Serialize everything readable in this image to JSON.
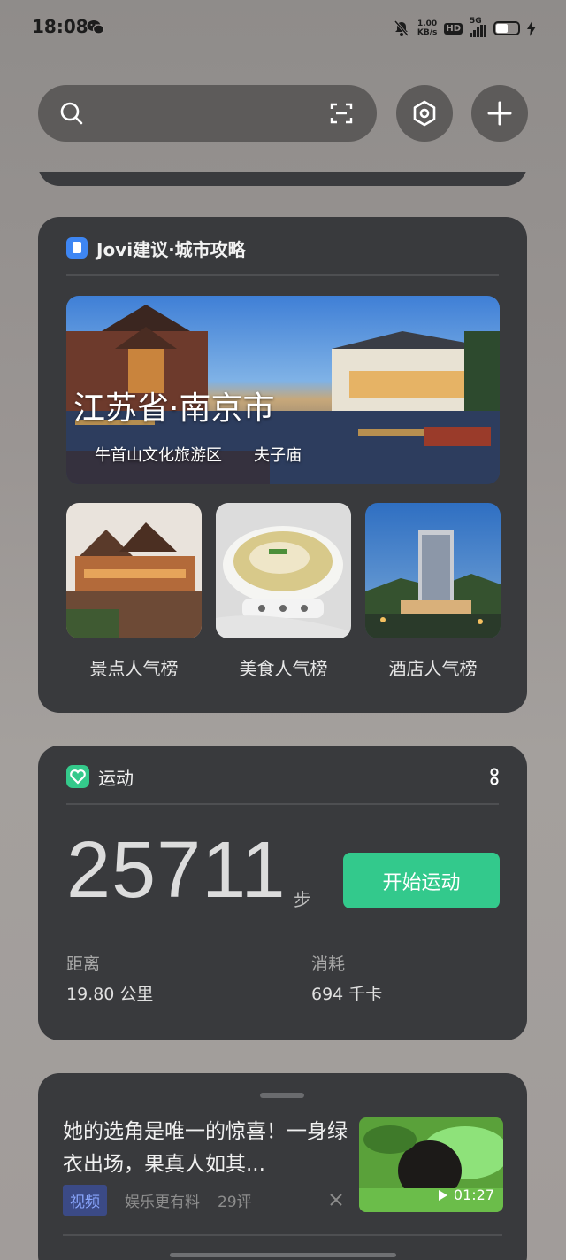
{
  "status_bar": {
    "time": "18:08",
    "net_speed_value": "1.00",
    "net_speed_unit": "KB/s",
    "hd_label": "HD",
    "network_label": "5G",
    "battery_level": 0.55,
    "icons": [
      "wechat-icon",
      "mute-icon",
      "signal-icon",
      "battery-icon",
      "charging-icon"
    ]
  },
  "search": {
    "icons": [
      "search-icon",
      "scan-icon"
    ]
  },
  "top_buttons": {
    "icons": [
      "settings-icon",
      "add-icon"
    ]
  },
  "jovi_card": {
    "title": "Jovi建议·城市攻略",
    "city": "江苏省·南京市",
    "attractions": [
      "牛首山文化旅游区",
      "夫子庙"
    ],
    "rankings": [
      {
        "label": "景点人气榜"
      },
      {
        "label": "美食人气榜"
      },
      {
        "label": "酒店人气榜"
      }
    ]
  },
  "sport_card": {
    "title": "运动",
    "steps": "25711",
    "steps_unit": "步",
    "start_button": "开始运动",
    "distance_label": "距离",
    "distance_value": "19.80 公里",
    "calories_label": "消耗",
    "calories_value": "694 千卡"
  },
  "news_card": {
    "title": "她的选角是唯一的惊喜！一身绿衣出场，果真人如其...",
    "tag": "视频",
    "source": "娱乐更有料",
    "comments": "29评",
    "duration": "01:27"
  },
  "colors": {
    "accent_green": "#33c98c",
    "card_bg": "#393a3d",
    "jovi_blue": "#3e86f3"
  }
}
